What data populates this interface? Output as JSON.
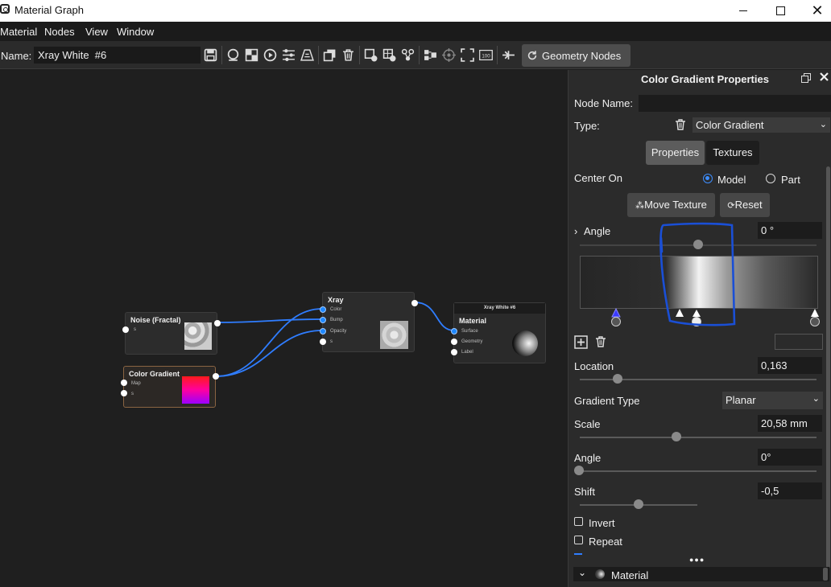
{
  "window": {
    "title": "Material Graph",
    "close_glyph": "✕"
  },
  "menu": [
    "Material",
    "Nodes",
    "View",
    "Window"
  ],
  "toolbar": {
    "name_label": "Name:",
    "name_value": "Xray White  #6",
    "geometry_nodes_label": "Geometry Nodes",
    "icons": [
      "save-icon",
      "sphere-preview-icon",
      "checker-icon",
      "play-icon",
      "sliders-icon",
      "perspective-icon",
      "duplicate-icon",
      "delete-icon",
      "add-material-icon",
      "add-texture-icon",
      "link-icon",
      "align-icon",
      "target-icon",
      "fit-icon",
      "zoom-100-icon",
      "graph-split-icon"
    ],
    "zoom_label": "100"
  },
  "graph": {
    "nodes": {
      "noise": {
        "title": "Noise (Fractal)",
        "ports": [
          "s"
        ]
      },
      "gradient": {
        "title": "Color Gradient",
        "ports": [
          "Map",
          "s"
        ]
      },
      "xray": {
        "title": "Xray",
        "ports": [
          "Color",
          "Bump",
          "Opacity",
          "s"
        ]
      },
      "material": {
        "header": "Xray White  #6",
        "title": "Material",
        "ports": [
          "Surface",
          "Geometry",
          "Label"
        ]
      }
    },
    "wire_color": "#2f7dff"
  },
  "panel": {
    "title": "Color Gradient Properties",
    "node_name_label": "Node Name:",
    "node_name_value": "",
    "type_label": "Type:",
    "type_value": "Color Gradient",
    "tabs": [
      "Properties",
      "Textures"
    ],
    "center_on_label": "Center On",
    "center_options": [
      "Model",
      "Part"
    ],
    "center_selected": "Model",
    "move_texture_label": "Move Texture",
    "reset_label": "Reset",
    "angle_label": "Angle",
    "angle_value": "0 °",
    "location_label": "Location",
    "location_value": "0,163",
    "gradient_type_label": "Gradient Type",
    "gradient_type_value": "Planar",
    "scale_label": "Scale",
    "scale_value": "20,58 mm",
    "angle2_label": "Angle",
    "angle2_value": "0°",
    "shift_label": "Shift",
    "shift_value": "-0,5",
    "invert_label": "Invert",
    "repeat_label": "Repeat",
    "more_glyph": "●●●",
    "material_section_label": "Material",
    "gradient_stop_locations": [
      0.163,
      0.5,
      1.0
    ],
    "annotation_color": "#1a4fd6"
  }
}
